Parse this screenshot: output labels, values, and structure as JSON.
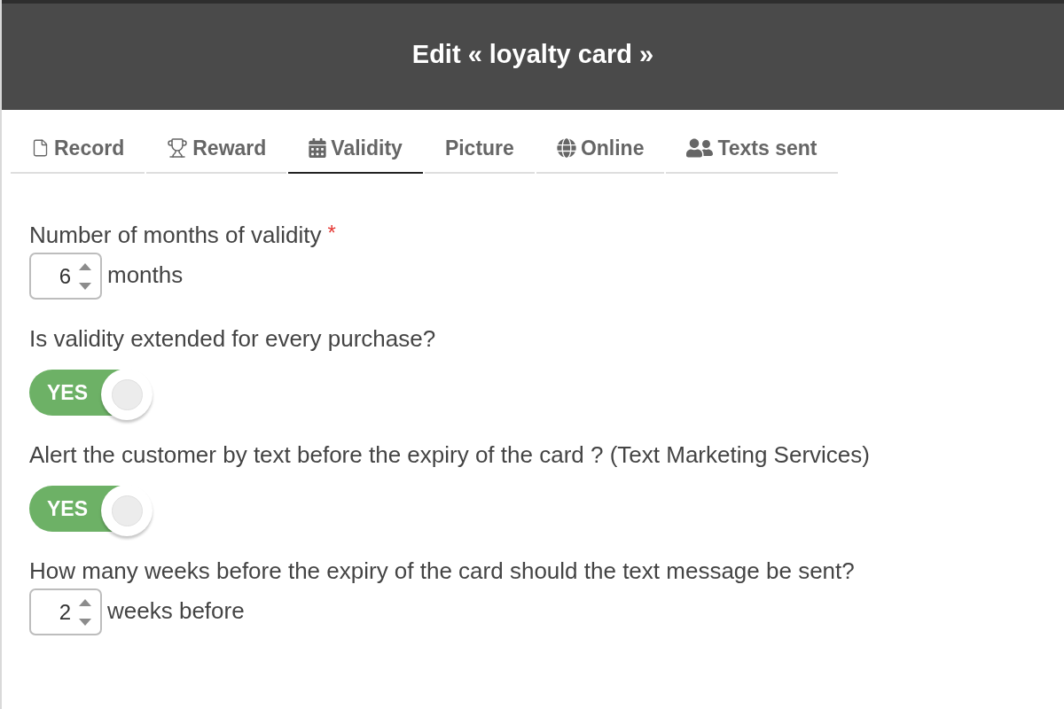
{
  "header": {
    "title": "Edit « loyalty card »"
  },
  "tabs": [
    {
      "label": "Record",
      "selected": false
    },
    {
      "label": "Reward",
      "selected": false
    },
    {
      "label": "Validity",
      "selected": true
    },
    {
      "label": "Picture",
      "selected": false
    },
    {
      "label": "Online",
      "selected": false
    },
    {
      "label": "Texts sent",
      "selected": false
    }
  ],
  "fields": [
    {
      "kind": "number",
      "label": "Number of months of validity",
      "required_mark": "*",
      "value": "6",
      "unit": "months"
    },
    {
      "kind": "toggle",
      "label": "Is validity extended for every purchase?",
      "on": true,
      "state_label": "YES"
    },
    {
      "kind": "toggle",
      "label": "Alert the customer by text before the expiry of the card ? (Text Marketing Services)",
      "on": true,
      "state_label": "YES"
    },
    {
      "kind": "number",
      "label": "How many weeks before the expiry of the card should the text message be sent?",
      "value": "2",
      "unit": "weeks before"
    }
  ]
}
